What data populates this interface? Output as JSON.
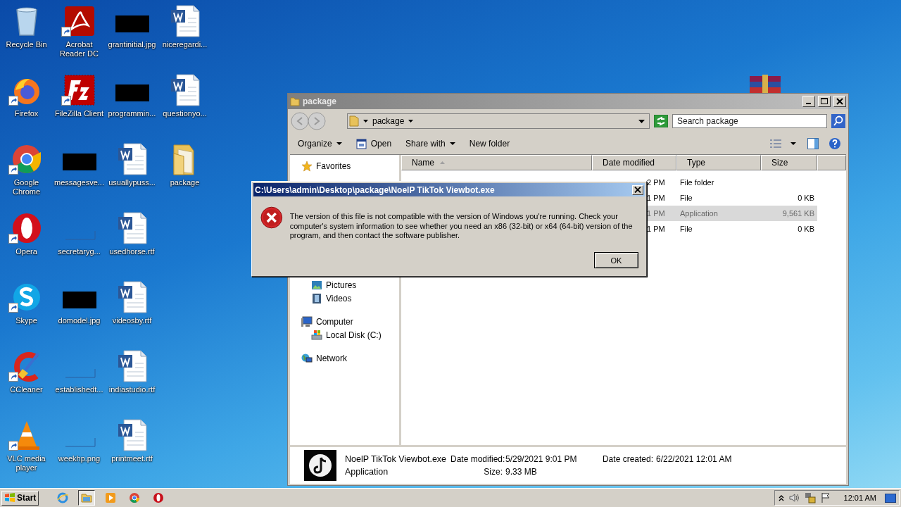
{
  "desktop_icons": [
    {
      "label": "Recycle Bin",
      "kind": "recycle",
      "shortcut": false
    },
    {
      "label": "Firefox",
      "kind": "firefox",
      "shortcut": true
    },
    {
      "label": "Google Chrome",
      "kind": "chrome",
      "shortcut": true
    },
    {
      "label": "Opera",
      "kind": "opera",
      "shortcut": true
    },
    {
      "label": "Skype",
      "kind": "skype",
      "shortcut": true
    },
    {
      "label": "CCleaner",
      "kind": "ccleaner",
      "shortcut": true
    },
    {
      "label": "VLC media player",
      "kind": "vlc",
      "shortcut": true
    },
    {
      "label": "Acrobat Reader DC",
      "kind": "acrobat",
      "shortcut": true
    },
    {
      "label": "FileZilla Client",
      "kind": "filezilla",
      "shortcut": true
    },
    {
      "label": "messagesve...",
      "kind": "photo",
      "shortcut": false
    },
    {
      "label": "secretaryg...",
      "kind": "blank",
      "shortcut": false
    },
    {
      "label": "domodel.jpg",
      "kind": "photo",
      "shortcut": false
    },
    {
      "label": "establishedt...",
      "kind": "blank",
      "shortcut": false
    },
    {
      "label": "weekhp.png",
      "kind": "blank",
      "shortcut": false
    },
    {
      "label": "grantinitial.jpg",
      "kind": "photo",
      "shortcut": false
    },
    {
      "label": "programmin...",
      "kind": "photo",
      "shortcut": false
    },
    {
      "label": "usuallypuss...",
      "kind": "document",
      "shortcut": false
    },
    {
      "label": "usedhorse.rtf",
      "kind": "document",
      "shortcut": false
    },
    {
      "label": "videosby.rtf",
      "kind": "document",
      "shortcut": false
    },
    {
      "label": "indiastudio.rtf",
      "kind": "document",
      "shortcut": false
    },
    {
      "label": "printmeet.rtf",
      "kind": "document",
      "shortcut": false
    },
    {
      "label": "niceregardi...",
      "kind": "document",
      "shortcut": false
    },
    {
      "label": "questionyo...",
      "kind": "document",
      "shortcut": false
    },
    {
      "label": "package",
      "kind": "folder",
      "shortcut": false
    }
  ],
  "explorer": {
    "title": "package",
    "address": "package",
    "search": {
      "placeholder": "Search package"
    },
    "toolbar": [
      {
        "label": "Organize",
        "kind": "menu"
      },
      {
        "label": "Open",
        "kind": "open"
      },
      {
        "label": "Share with",
        "kind": "menu"
      },
      {
        "label": "New folder",
        "kind": "plain"
      }
    ],
    "nav": [
      {
        "label": "Favorites",
        "kind": "star"
      },
      {
        "kind": "group",
        "children": [
          {
            "label": "Pictures",
            "kind": "pictures"
          },
          {
            "label": "Videos",
            "kind": "videos"
          }
        ]
      },
      {
        "label": "Computer",
        "kind": "computer",
        "children": [
          {
            "label": "Local Disk (C:)",
            "kind": "disk"
          }
        ]
      },
      {
        "label": "Network",
        "kind": "network"
      }
    ],
    "columns": [
      {
        "label": "Name",
        "sorted": true
      },
      {
        "label": "Date modified",
        "sorted": false
      },
      {
        "label": "Type",
        "sorted": false
      },
      {
        "label": "Size",
        "sorted": false
      }
    ],
    "rows": [
      {
        "date": "2 PM",
        "type": "File folder",
        "selected": false
      },
      {
        "date": "1 PM",
        "type": "File",
        "size": "0 KB",
        "selected": false
      },
      {
        "date": "1 PM",
        "type": "Application",
        "size": "9,561 KB",
        "selected": true
      },
      {
        "date": "1 PM",
        "type": "File",
        "size": "0 KB",
        "selected": false
      }
    ],
    "details": {
      "name": "NoelP TikTok Viewbot.exe",
      "type": "Application",
      "modified_label": "Date modified:",
      "modified": "5/29/2021 9:01 PM",
      "created_label": "Date created:",
      "created": "6/22/2021 12:01 AM",
      "size_label": "Size:",
      "size": "9.33 MB"
    }
  },
  "dialog": {
    "title": "C:\\Users\\admin\\Desktop\\package\\NoelP TikTok Viewbot.exe",
    "message": "The version of this file is not compatible with the version of Windows you're running. Check your computer's system information to see whether you need an x86 (32-bit) or x64 (64-bit) version of the program, and then contact the software publisher.",
    "button": "OK"
  },
  "taskbar": {
    "start": "Start",
    "apps": [
      {
        "kind": "ie",
        "active": false
      },
      {
        "kind": "explorer",
        "active": true
      },
      {
        "kind": "media",
        "active": false
      },
      {
        "kind": "chrome",
        "active": false
      },
      {
        "kind": "opera",
        "active": false
      }
    ],
    "clock": "12:01 AM"
  }
}
